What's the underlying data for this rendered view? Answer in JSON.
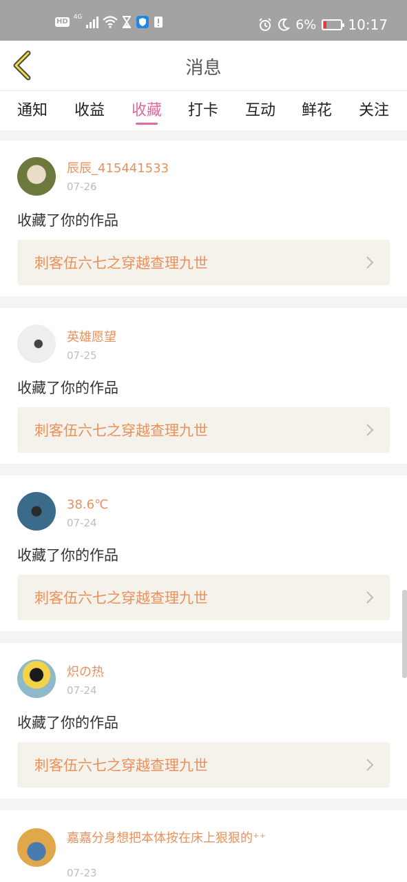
{
  "status_bar": {
    "network_badge": "HD",
    "network_gen": "4G",
    "battery": "6%",
    "time": "10:17",
    "battery_color": "#e53935"
  },
  "header": {
    "title": "消息",
    "back_icon": "chevron-left-icon"
  },
  "tabs": [
    {
      "label": "通知",
      "active": false
    },
    {
      "label": "收益",
      "active": false
    },
    {
      "label": "收藏",
      "active": true
    },
    {
      "label": "打卡",
      "active": false
    },
    {
      "label": "互动",
      "active": false
    },
    {
      "label": "鲜花",
      "active": false
    },
    {
      "label": "关注",
      "active": false
    }
  ],
  "colors": {
    "accent": "#e06aa0",
    "username": "#e8915d",
    "work_bg": "#f4f2ea"
  },
  "notifications": [
    {
      "user": "辰辰_415441533",
      "date": "07-26",
      "action": "收藏了你的作品",
      "work": "刺客伍六七之穿越查理九世"
    },
    {
      "user": "英雄愿望",
      "date": "07-25",
      "action": "收藏了你的作品",
      "work": "刺客伍六七之穿越查理九世"
    },
    {
      "user": "38.6℃",
      "date": "07-24",
      "action": "收藏了你的作品",
      "work": "刺客伍六七之穿越查理九世"
    },
    {
      "user": "炽の热",
      "date": "07-24",
      "action": "收藏了你的作品",
      "work": "刺客伍六七之穿越查理九世"
    },
    {
      "user": "嘉嘉分身想把本体按在床上狠狠的⁺⁺",
      "date": "07-23",
      "action": "",
      "work": ""
    }
  ]
}
